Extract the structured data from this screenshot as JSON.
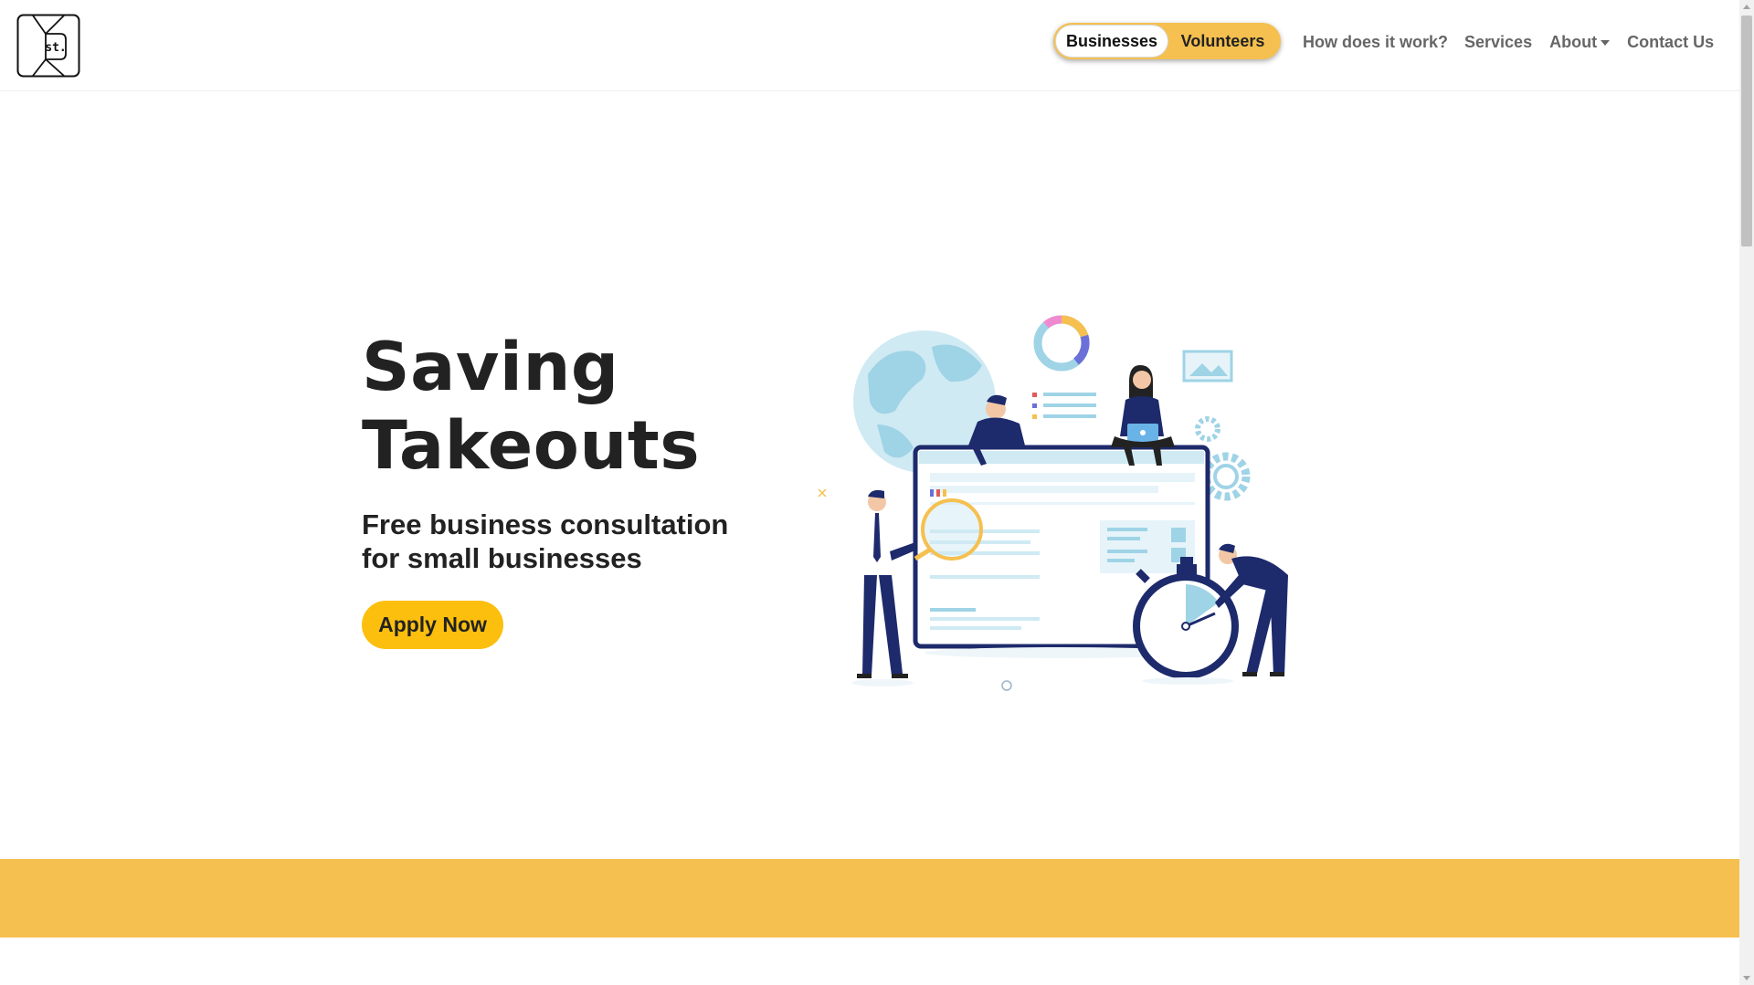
{
  "header": {
    "logo_text": "st.",
    "toggle": {
      "active_label": "Businesses",
      "inactive_label": "Volunteers"
    },
    "nav": {
      "how_it_works": "How does it work?",
      "services": "Services",
      "about": "About",
      "contact": "Contact Us"
    }
  },
  "hero": {
    "title_line1": "Saving",
    "title_line2": "Takeouts",
    "subtitle_line1": "Free business consultation",
    "subtitle_line2": "for small businesses",
    "cta_label": "Apply Now"
  },
  "colors": {
    "accent_yellow": "#f5c04f",
    "button_yellow": "#fcbf0e",
    "illustration_navy": "#1d2a6b",
    "illustration_lightblue": "#9fd3e6"
  },
  "icons": {
    "logo": "envelope-logo-icon",
    "about_dropdown": "caret-down-icon"
  }
}
